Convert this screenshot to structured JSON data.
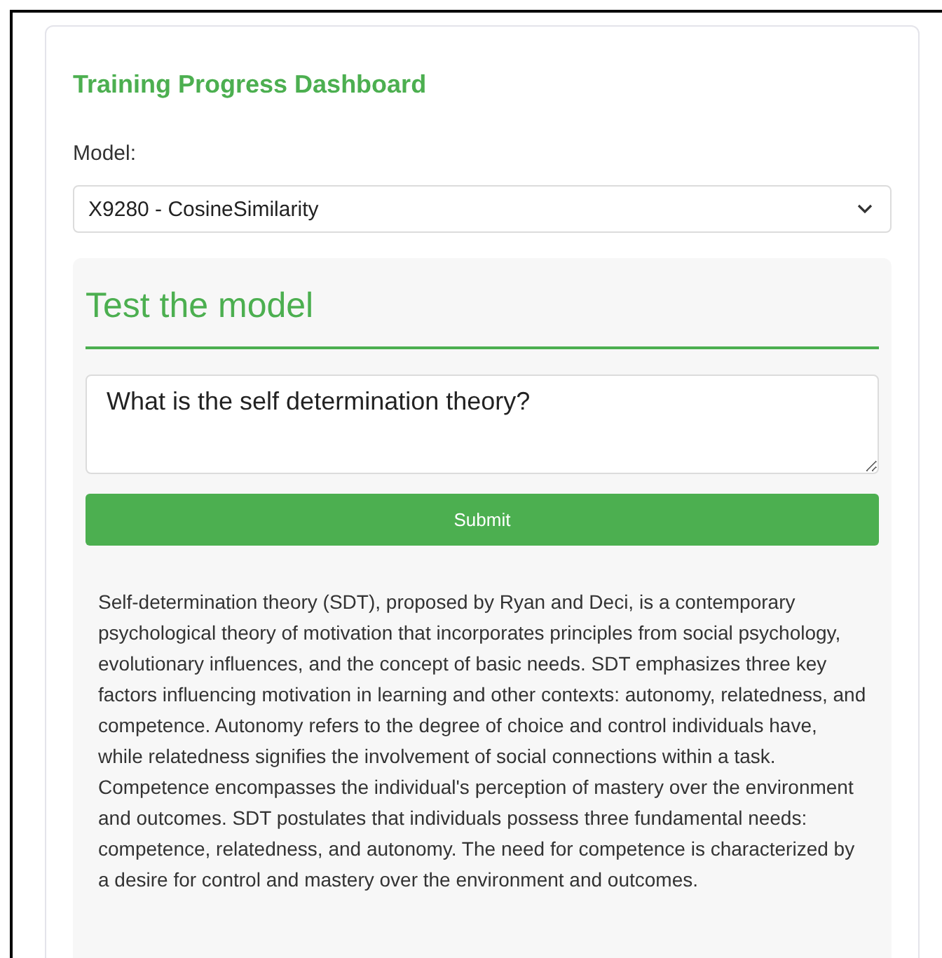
{
  "title": "Training Progress Dashboard",
  "model_label": "Model:",
  "model_select": {
    "value": "X9280 - CosineSimilarity"
  },
  "test_panel": {
    "heading": "Test the model",
    "question": {
      "value": "What is the self determination theory?"
    },
    "submit_button": "Submit",
    "response": "Self-determination theory (SDT), proposed by Ryan and Deci, is a contemporary psychological theory of motivation that incorporates principles from social psychology, evolutionary influences, and the concept of basic needs. SDT emphasizes three key factors influencing motivation in learning and other contexts: autonomy, relatedness, and competence. Autonomy refers to the degree of choice and control individuals have, while relatedness signifies the involvement of social connections within a task. Competence encompasses the individual's perception of mastery over the environment and outcomes. SDT postulates that individuals possess three fundamental needs: competence, relatedness, and autonomy. The need for competence is characterized by a desire for control and mastery over the environment and outcomes."
  }
}
